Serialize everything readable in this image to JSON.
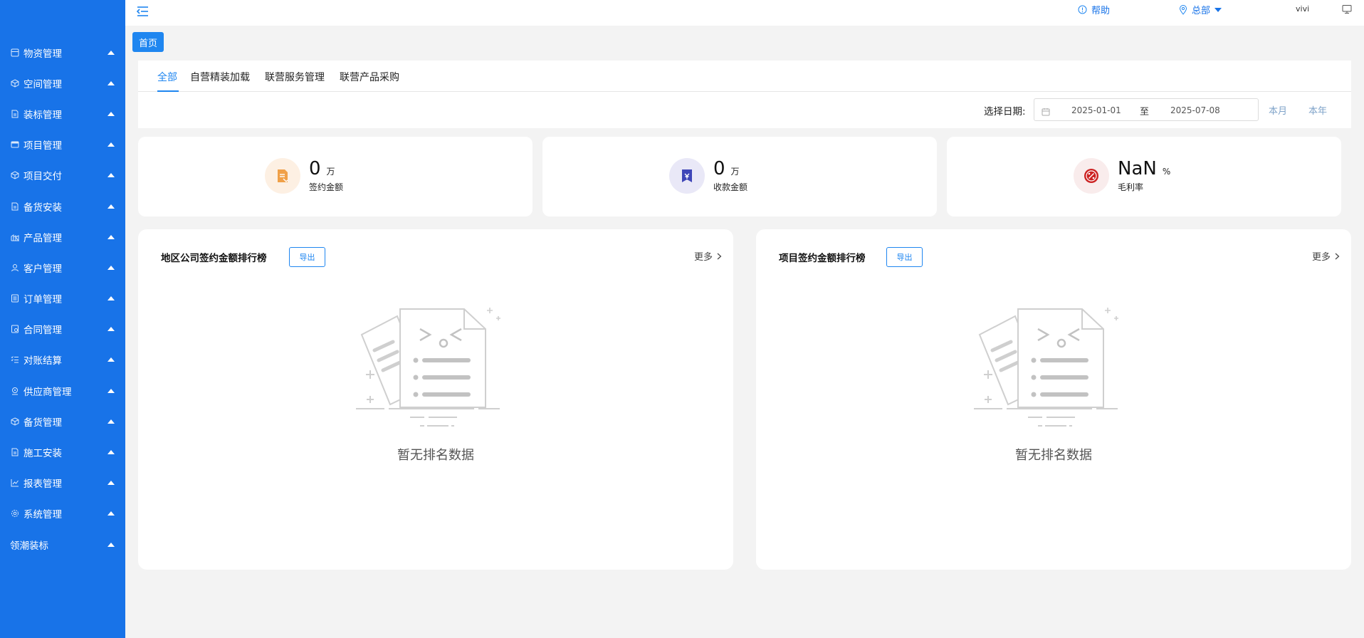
{
  "sidebar": {
    "items": [
      {
        "label": "物资管理",
        "icon": "box-icon"
      },
      {
        "label": "空间管理",
        "icon": "cube-icon"
      },
      {
        "label": "装标管理",
        "icon": "doc-icon"
      },
      {
        "label": "项目管理",
        "icon": "card-icon"
      },
      {
        "label": "项目交付",
        "icon": "cube-icon"
      },
      {
        "label": "备货安装",
        "icon": "doc-icon"
      },
      {
        "label": "产品管理",
        "icon": "factory-icon"
      },
      {
        "label": "客户管理",
        "icon": "user-icon"
      },
      {
        "label": "订单管理",
        "icon": "list-icon"
      },
      {
        "label": "合同管理",
        "icon": "contract-icon"
      },
      {
        "label": "对账结算",
        "icon": "checklist-icon"
      },
      {
        "label": "供应商管理",
        "icon": "supplier-icon"
      },
      {
        "label": "备货管理",
        "icon": "cube-icon"
      },
      {
        "label": "施工安装",
        "icon": "doc-icon"
      },
      {
        "label": "报表管理",
        "icon": "chart-icon"
      },
      {
        "label": "系统管理",
        "icon": "gear-icon"
      },
      {
        "label": "领潮装标",
        "icon": ""
      }
    ]
  },
  "header": {
    "help": "帮助",
    "location": "总部",
    "user": "vivi"
  },
  "home_tab": "首页",
  "tabs": [
    "全部",
    "自营精装加载",
    "联营服务管理",
    "联营产品采购"
  ],
  "active_tab": 0,
  "date_filter": {
    "label": "选择日期:",
    "start": "2025-01-01",
    "separator": "至",
    "end": "2025-07-08",
    "this_month": "本月",
    "this_year": "本年"
  },
  "stats": [
    {
      "value": "0",
      "unit": "万",
      "label": "签约金额",
      "icon_bg": "#fdf0e3",
      "icon_color": "#f0a048"
    },
    {
      "value": "0",
      "unit": "万",
      "label": "收款金额",
      "icon_bg": "#e9e8f7",
      "icon_color": "#3f46b8"
    },
    {
      "value": "NaN",
      "unit": "%",
      "label": "毛利率",
      "icon_bg": "#f9ecec",
      "icon_color": "#cc2222"
    }
  ],
  "rankings": [
    {
      "title": "地区公司签约金额排行榜",
      "export": "导出",
      "more": "更多",
      "empty": "暂无排名数据"
    },
    {
      "title": "项目签约金额排行榜",
      "export": "导出",
      "more": "更多",
      "empty": "暂无排名数据"
    }
  ],
  "colors": {
    "primary": "#1873e8",
    "accent": "#1f86f0",
    "page_bg": "#f3f3f3"
  }
}
